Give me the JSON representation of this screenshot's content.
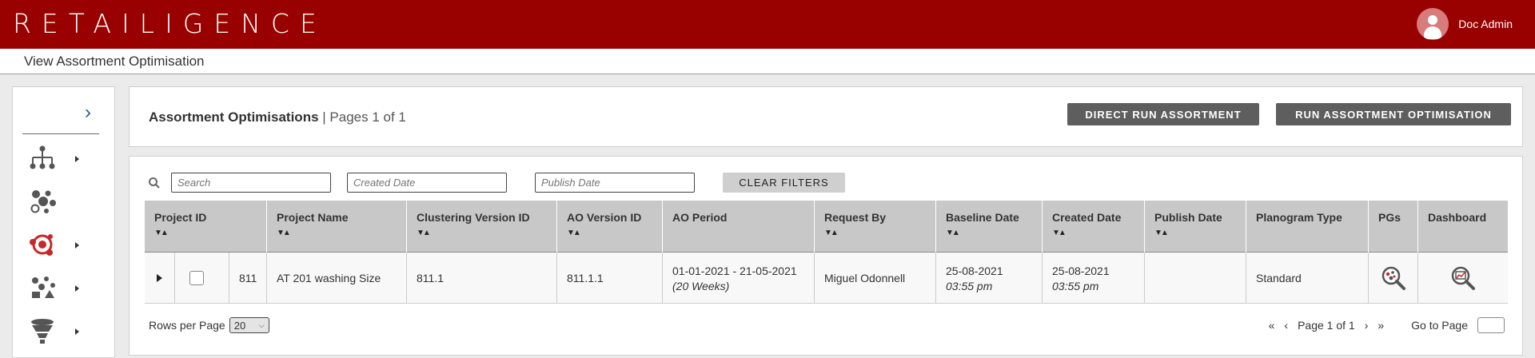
{
  "app": {
    "brand": "RETAILIGENCE",
    "user_name": "Doc Admin",
    "page_title": "View Assortment Optimisation"
  },
  "sidebar": {
    "items": [
      {
        "icon": "hierarchy-icon",
        "has_submenu": true
      },
      {
        "icon": "clustering-icon",
        "has_submenu": false
      },
      {
        "icon": "assortment-optimisation-icon",
        "has_submenu": true,
        "active_color": "#c62828"
      },
      {
        "icon": "space-planning-icon",
        "has_submenu": true
      },
      {
        "icon": "funnel-icon",
        "has_submenu": true
      }
    ]
  },
  "header": {
    "title": "Assortment Optimisations",
    "pages": "| Pages 1 of 1",
    "direct_run_label": "DIRECT RUN ASSORTMENT",
    "run_label": "RUN ASSORTMENT OPTIMISATION"
  },
  "filters": {
    "search_placeholder": "Search",
    "created_placeholder": "Created Date",
    "publish_placeholder": "Publish Date",
    "clear_label": "CLEAR FILTERS"
  },
  "table": {
    "columns": [
      "Project ID",
      "Project Name",
      "Clustering Version ID",
      "AO Version ID",
      "AO Period",
      "Request By",
      "Baseline Date",
      "Created Date",
      "Publish Date",
      "Planogram Type",
      "PGs",
      "Dashboard"
    ],
    "rows": [
      {
        "project_id": "811",
        "project_name": "AT 201 washing Size",
        "clustering_version_id": "811.1",
        "ao_version_id": "811.1.1",
        "ao_period": "01-01-2021 - 21-05-2021",
        "ao_period_weeks": "(20 Weeks)",
        "request_by": "Miguel Odonnell",
        "baseline_date": "25-08-2021",
        "baseline_time": "03:55 pm",
        "created_date": "25-08-2021",
        "created_time": "03:55 pm",
        "publish_date": "",
        "planogram_type": "Standard"
      }
    ]
  },
  "footer": {
    "rows_per_page_label": "Rows per Page",
    "rows_per_page_value": "20",
    "page_label": "Page 1 of 1",
    "goto_label": "Go to Page"
  },
  "colors": {
    "brand": "#990000",
    "accent_red": "#c62828",
    "button_dark": "#5e5e5e"
  }
}
